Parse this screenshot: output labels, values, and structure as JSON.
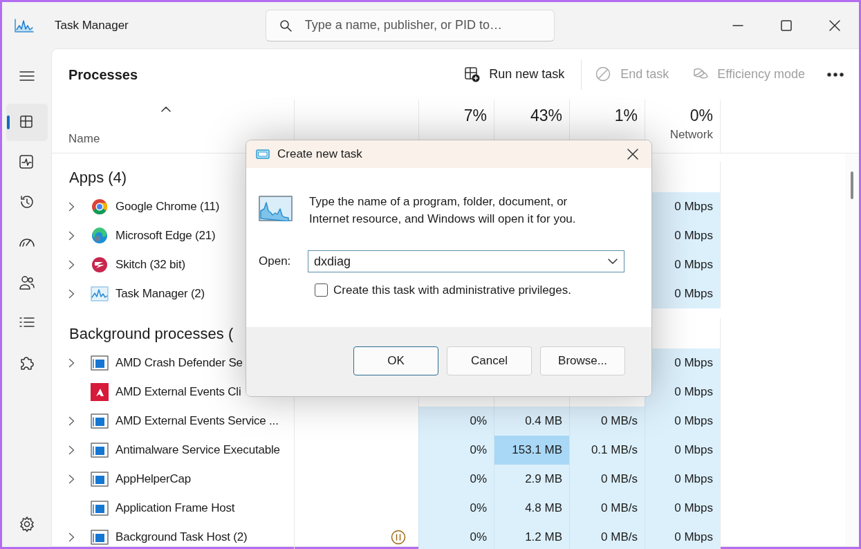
{
  "window": {
    "title": "Task Manager",
    "search": {
      "placeholder": "Type a name, publisher, or PID to…"
    }
  },
  "nav": [
    {
      "selected": false
    },
    {
      "selected": true
    },
    {
      "selected": false
    },
    {
      "selected": false
    },
    {
      "selected": false
    },
    {
      "selected": false
    },
    {
      "selected": false
    },
    {
      "selected": false
    }
  ],
  "nav_footer": [
    {
      "selected": false
    }
  ],
  "page": {
    "title": "Processes",
    "actions": [
      {
        "label": "Run new task",
        "disabled": false
      },
      {
        "label": "End task",
        "disabled": true
      },
      {
        "label": "Efficiency mode",
        "disabled": true
      }
    ]
  },
  "table": {
    "columns": [
      {
        "kind": "name",
        "label": "Name"
      },
      {
        "kind": "status"
      },
      {
        "kind": "cpu",
        "usage": "7%"
      },
      {
        "kind": "memory",
        "usage": "43%"
      },
      {
        "kind": "disk",
        "usage": "1%"
      },
      {
        "kind": "network",
        "usage": "0%",
        "label": "Network"
      }
    ],
    "groups": [
      {
        "title": "Apps (4)",
        "rows": [
          {
            "name": "Google Chrome (11)",
            "expandable": true,
            "suspended": false,
            "network": "0 Mbps"
          },
          {
            "name": "Microsoft Edge (21)",
            "expandable": true,
            "suspended": false,
            "network": "0 Mbps"
          },
          {
            "name": "Skitch (32 bit)",
            "expandable": true,
            "suspended": false,
            "network": "0 Mbps"
          },
          {
            "name": "Task Manager (2)",
            "expandable": true,
            "suspended": false,
            "network": "0 Mbps"
          }
        ]
      },
      {
        "title": "Background processes (",
        "rows": [
          {
            "name": "AMD Crash Defender Se",
            "expandable": true,
            "suspended": false,
            "network": "0 Mbps"
          },
          {
            "name": "AMD External Events Cli",
            "expandable": false,
            "suspended": false,
            "network": "0 Mbps"
          },
          {
            "name": "AMD External Events Service ...",
            "expandable": true,
            "suspended": false,
            "cpu": "0%",
            "memory": "0.4 MB",
            "memory_high": false,
            "disk": "0 MB/s",
            "network": "0 Mbps"
          },
          {
            "name": "Antimalware Service Executable",
            "expandable": true,
            "suspended": false,
            "cpu": "0%",
            "memory": "153.1 MB",
            "memory_high": true,
            "disk": "0.1 MB/s",
            "network": "0 Mbps"
          },
          {
            "name": "AppHelperCap",
            "expandable": true,
            "suspended": false,
            "cpu": "0%",
            "memory": "2.9 MB",
            "memory_high": false,
            "disk": "0 MB/s",
            "network": "0 Mbps"
          },
          {
            "name": "Application Frame Host",
            "expandable": false,
            "suspended": false,
            "cpu": "0%",
            "memory": "4.8 MB",
            "memory_high": false,
            "disk": "0 MB/s",
            "network": "0 Mbps"
          },
          {
            "name": "Background Task Host (2)",
            "expandable": true,
            "suspended": true,
            "cpu": "0%",
            "memory": "1.2 MB",
            "memory_high": false,
            "disk": "0 MB/s",
            "network": "0 Mbps"
          }
        ]
      }
    ]
  },
  "dialog": {
    "title": "Create new task",
    "message": "Type the name of a program, folder, document, or Internet resource, and Windows will open it for you.",
    "open_label": "Open:",
    "value": "dxdiag",
    "checkbox": {
      "label": "Create this task with administrative privileges.",
      "checked": false
    },
    "buttons": [
      {
        "label": "OK",
        "default": true
      },
      {
        "label": "Cancel",
        "default": false
      },
      {
        "label": "Browse...",
        "default": false
      }
    ]
  }
}
